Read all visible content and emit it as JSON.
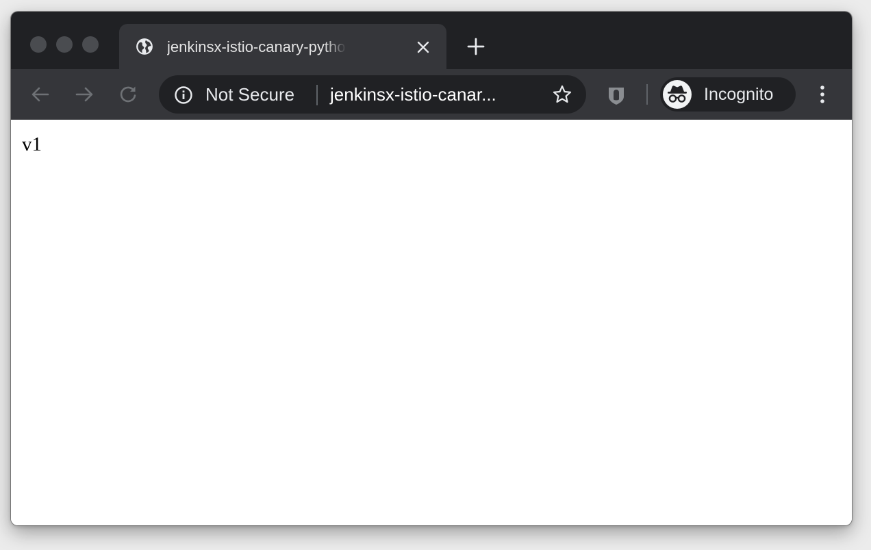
{
  "colors": {
    "titlebar": "#202124",
    "toolbar": "#35363a",
    "active_tab": "#35363a",
    "omnibox": "#202124",
    "traffic_light": "#4a4c50",
    "icon": "#9aa0a6",
    "text_light": "#e8eaed",
    "content_background": "#ffffff"
  },
  "window": {
    "traffic_lights": [
      "close",
      "minimize",
      "zoom"
    ]
  },
  "tab": {
    "title": "jenkinsx-istio-canary-python-t",
    "favicon": "globe-icon",
    "close_icon": "close-icon"
  },
  "new_tab": {
    "icon": "plus-icon"
  },
  "toolbar": {
    "back_icon": "arrow-left-icon",
    "forward_icon": "arrow-right-icon",
    "reload_icon": "reload-icon",
    "extension_icon": "shield-icon",
    "menu_icon": "kebab-menu-icon"
  },
  "omnibox": {
    "security_icon": "info-icon",
    "security_label": "Not Secure",
    "url": "jenkinsx-istio-canar...",
    "bookmark_icon": "star-icon"
  },
  "profile": {
    "icon": "incognito-icon",
    "label": "Incognito"
  },
  "page": {
    "body_text": "v1"
  }
}
